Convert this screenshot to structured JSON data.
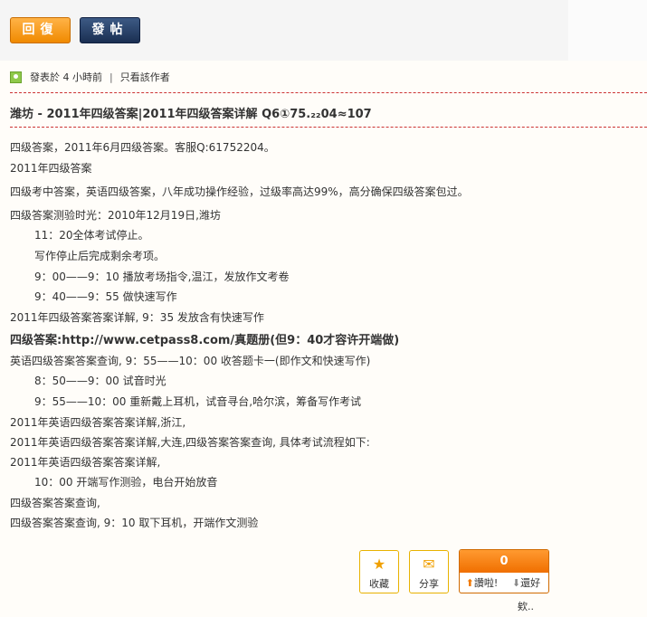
{
  "toolbar": {
    "reply_label": "回復",
    "post_label": "發帖"
  },
  "meta": {
    "posted": "發表於 4 小時前",
    "divider": "|",
    "only_author": "只看該作者"
  },
  "post": {
    "title": "潍坊 - 2011年四级答案|2011年四级答案详解 Q6①75.₂₂04≈107",
    "lines": [
      "四级答案，2011年6月四级答案。客服Q:61752204。",
      "2011年四级答案",
      "四级考中答案，英语四级答案，八年成功操作经验，过级率高达99%，高分确保四级答案包过。",
      "四级答案测验时光：2010年12月19日,潍坊",
      "11：20全体考试停止。",
      "写作停止后完成剩余考项。",
      "9：00——9：10 播放考场指令,温江，发放作文考卷",
      "9：40——9：55 做快速写作",
      "2011年四级答案答案详解,       9：35 发放含有快速写作",
      "四级答案:http://www.cetpass8.com/真题册(但9：40才容许开端做)",
      "英语四级答案答案查询,        9：55——10：00 收答题卡一(即作文和快速写作)",
      "8：50——9：00 试音时光",
      "9：55——10：00 重新戴上耳机，试音寻台,哈尔滨，筹备写作考试",
      "2011年英语四级答案答案详解,浙江,",
      "2011年英语四级答案答案详解,大连,四级答案答案查询,       具体考试流程如下:",
      "2011年英语四级答案答案详解,",
      "10：00 开端写作测验，电台开始放音",
      "四级答案答案查询,",
      "四级答案答案查询,       9：10 取下耳机，开端作文测验"
    ]
  },
  "actions": {
    "favorite": "收藏",
    "share": "分享"
  },
  "vote": {
    "count": "0",
    "up": "讚啦!",
    "down": "還好"
  },
  "tail_text": "欸..",
  "colors": {
    "accent": "#f08a00",
    "dash": "#cc3333",
    "post_btn": "#1a2f52"
  },
  "icons": [
    "user-icon",
    "star-icon",
    "share-icon",
    "thumb-up-icon",
    "thumb-down-icon"
  ]
}
